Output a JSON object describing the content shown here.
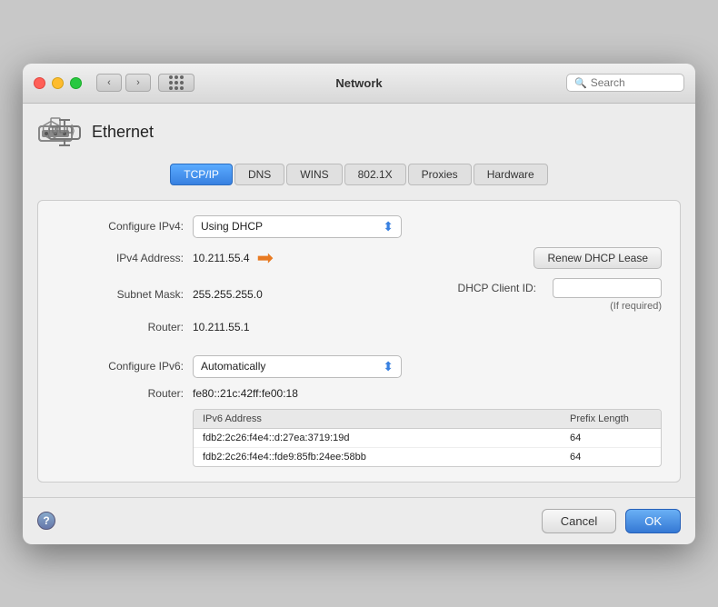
{
  "titlebar": {
    "title": "Network",
    "search_placeholder": "Search"
  },
  "ethernet": {
    "label": "Ethernet"
  },
  "tabs": [
    {
      "id": "tcpip",
      "label": "TCP/IP",
      "active": true
    },
    {
      "id": "dns",
      "label": "DNS",
      "active": false
    },
    {
      "id": "wins",
      "label": "WINS",
      "active": false
    },
    {
      "id": "8021x",
      "label": "802.1X",
      "active": false
    },
    {
      "id": "proxies",
      "label": "Proxies",
      "active": false
    },
    {
      "id": "hardware",
      "label": "Hardware",
      "active": false
    }
  ],
  "tcpip": {
    "configure_ipv4_label": "Configure IPv4:",
    "configure_ipv4_value": "Using DHCP",
    "ipv4_address_label": "IPv4 Address:",
    "ipv4_address_value": "10.211.55.4",
    "subnet_mask_label": "Subnet Mask:",
    "subnet_mask_value": "255.255.255.0",
    "router_ipv4_label": "Router:",
    "router_ipv4_value": "10.211.55.1",
    "renew_btn_label": "Renew DHCP Lease",
    "dhcp_client_id_label": "DHCP Client ID:",
    "dhcp_if_required": "(If required)",
    "configure_ipv6_label": "Configure IPv6:",
    "configure_ipv6_value": "Automatically",
    "router_ipv6_label": "Router:",
    "router_ipv6_value": "fe80::21c:42ff:fe00:18",
    "ipv6_table": {
      "col_address": "IPv6 Address",
      "col_prefix": "Prefix Length",
      "rows": [
        {
          "address": "fdb2:2c26:f4e4::d:27ea:3719:19d",
          "prefix": "64"
        },
        {
          "address": "fdb2:2c26:f4e4::fde9:85fb:24ee:58bb",
          "prefix": "64"
        }
      ]
    }
  },
  "bottom": {
    "cancel_label": "Cancel",
    "ok_label": "OK"
  }
}
